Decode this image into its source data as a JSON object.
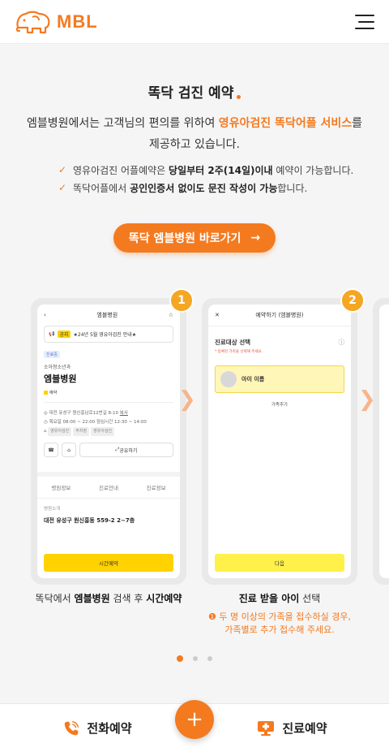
{
  "header": {
    "logo_text": "MBL",
    "menu_icon": "hamburger-icon"
  },
  "intro": {
    "title": "똑닥 검진 예약",
    "desc_part1": "엠블병원에서는 고객님의 편의를 위하여 ",
    "desc_highlight": "영유아검진 똑닥어플 서비스",
    "desc_part2": "를",
    "desc_line2": "제공하고 있습니다.",
    "check1": {
      "a": "영유아검진 어플예약은 ",
      "b": "당일부터 2주(14일)이내",
      "c": " 예약이 가능합니다."
    },
    "check2": {
      "a": "똑닥어플에서 ",
      "b": "공인인증서 없이도 문진 작성이 가능",
      "c": "합니다."
    }
  },
  "cta": {
    "label": "똑닥 엠블병원 바로가기",
    "arrow": "→"
  },
  "slides": [
    {
      "badge": "1",
      "screen": {
        "title": "엠블병원",
        "notice_tag": "공지",
        "notice": "★24년 5월 영유아검진 안내★",
        "chip": "진료중",
        "sub": "소아청소년과",
        "name": "엠블병원",
        "pay": "예약",
        "addr_line": "대전 유성구 원신흥남로12번길 8-10",
        "addr_more": "복사",
        "hours": "목요일 08:00 ~ 22:00  점심시간 12:30 ~ 14:00",
        "tags": [
          "영유아검진",
          "주차장",
          "영유아검진"
        ],
        "share": "공유하기",
        "tabs": [
          "병원정보",
          "진료안내",
          "진료정보"
        ],
        "sec": "병원소개",
        "address": "대전 유성구 원신흥동 559-2 2~7층",
        "button": "시간예약"
      },
      "caption": {
        "a": "똑닥에서 ",
        "b": "엠블병원",
        "c": " 검색 후 ",
        "d": "시간예약"
      }
    },
    {
      "badge": "2",
      "screen": {
        "title": "예약하기 (엠블병원)",
        "heading": "진료대상 선택",
        "hint": "* 등록된 가족을 선택해 주세요.",
        "child": "아이 이름",
        "add": "가족추가",
        "button": "다음"
      },
      "caption": {
        "b": "진료 받을 아이",
        "c": " 선택"
      },
      "note": {
        "line1": "두 명 이상의 가족을 접수하실 경우,",
        "line2": "가족별로 추가 접수해 주세요."
      }
    }
  ],
  "pagination": {
    "count": 3,
    "active": 1
  },
  "bottom_bar": {
    "phone": "전화예약",
    "fab": "+",
    "booking": "진료예약"
  },
  "colors": {
    "accent": "#f47a20",
    "yellow": "#ffd200",
    "badge": "#f5a623"
  }
}
